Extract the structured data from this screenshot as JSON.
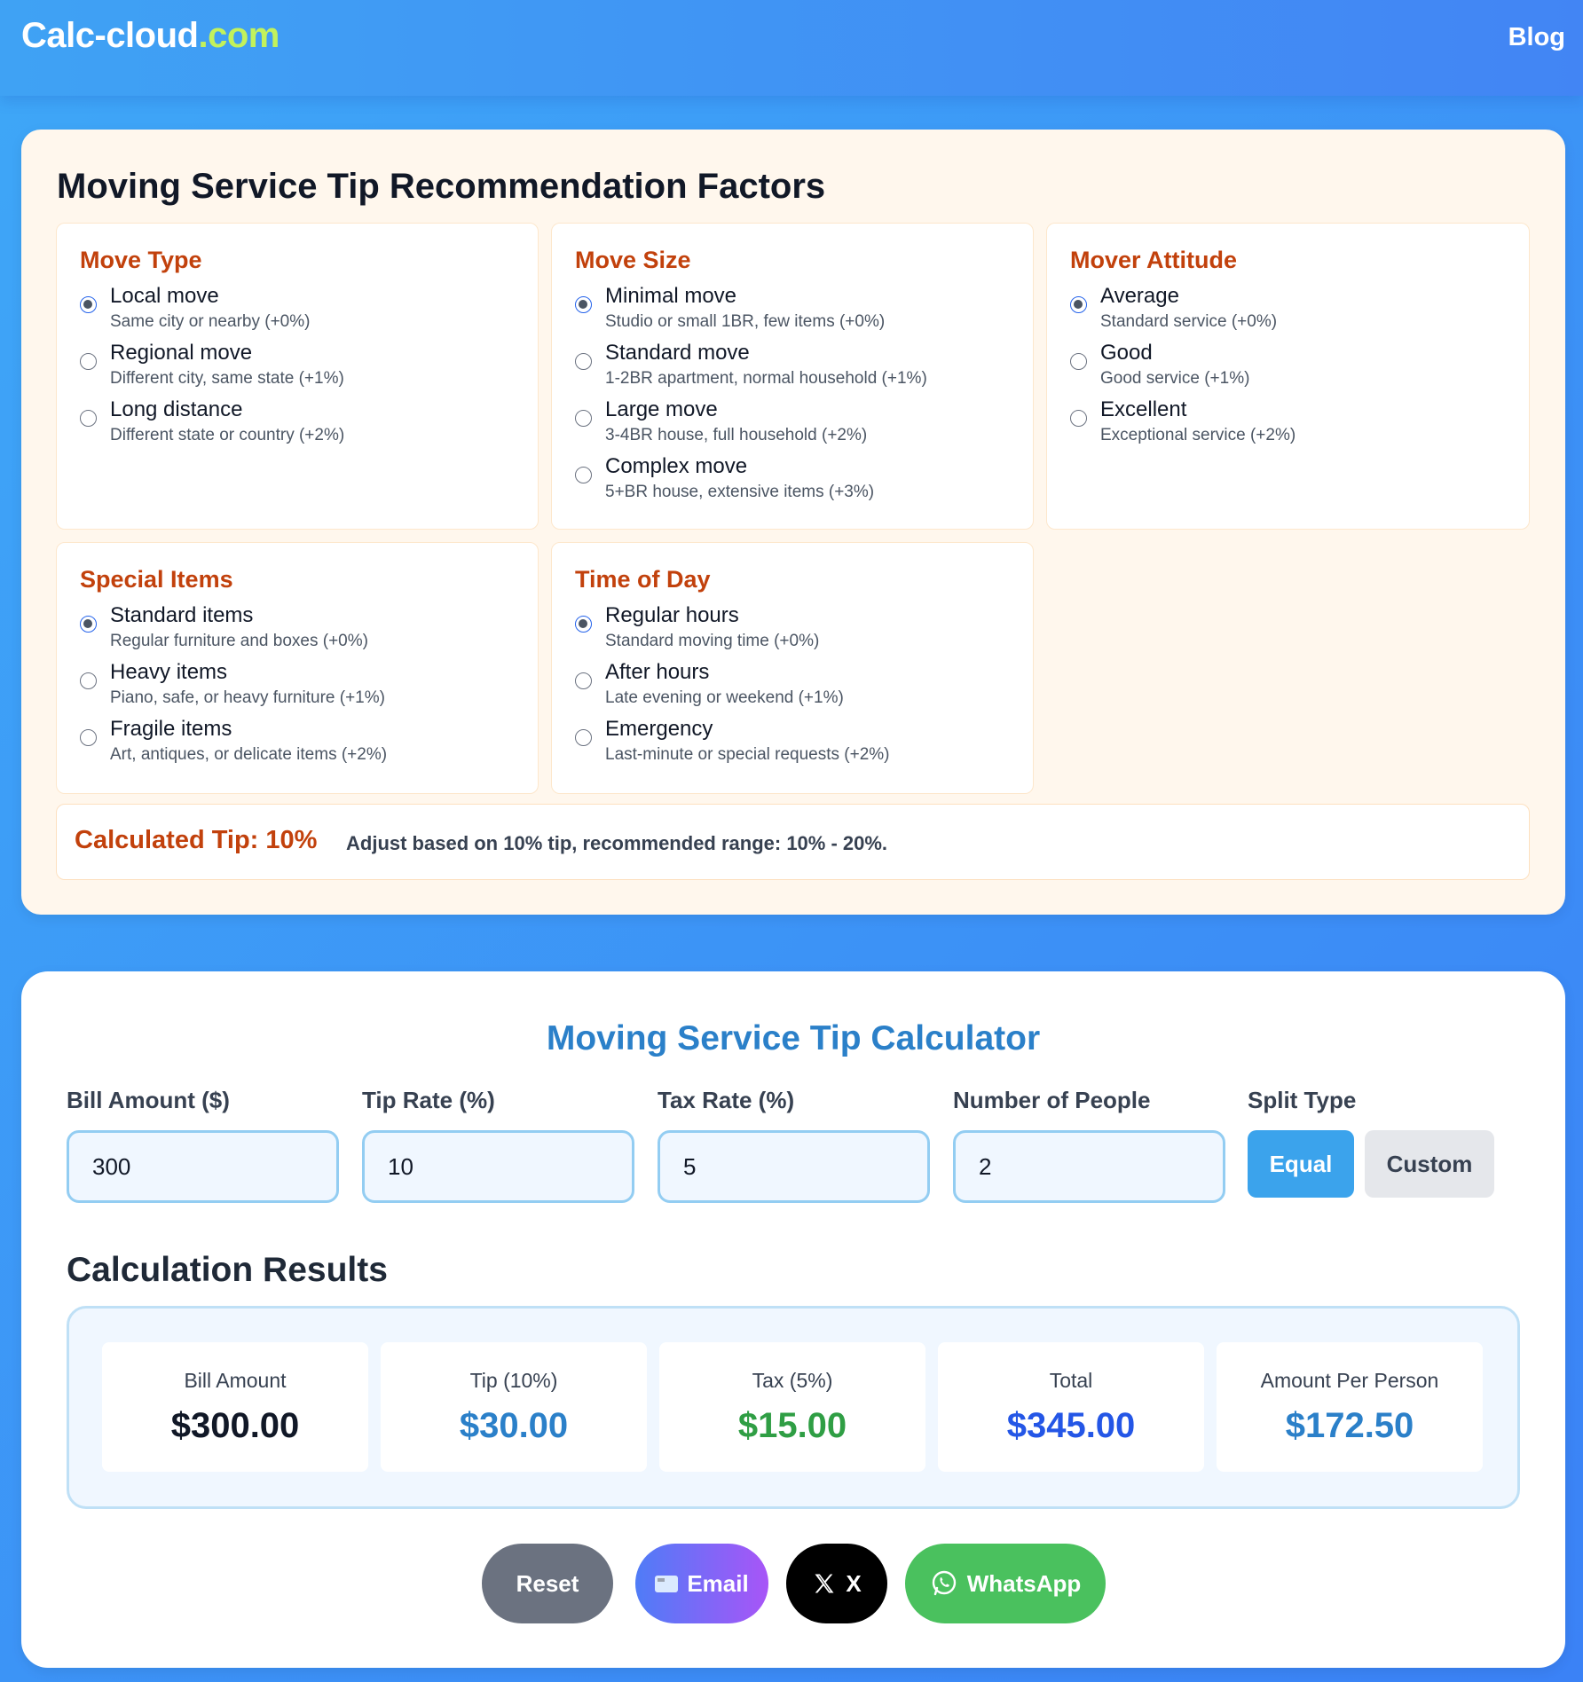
{
  "header": {
    "logo_main": "Calc-cloud",
    "logo_tld": ".com",
    "nav_blog": "Blog"
  },
  "factors": {
    "title": "Moving Service Tip Recommendation Factors",
    "move_type": {
      "title": "Move Type",
      "options": [
        {
          "label": "Local move",
          "desc": "Same city or nearby (+0%)",
          "checked": true
        },
        {
          "label": "Regional move",
          "desc": "Different city, same state (+1%)",
          "checked": false
        },
        {
          "label": "Long distance",
          "desc": "Different state or country (+2%)",
          "checked": false
        }
      ]
    },
    "move_size": {
      "title": "Move Size",
      "options": [
        {
          "label": "Minimal move",
          "desc": "Studio or small 1BR, few items (+0%)",
          "checked": true
        },
        {
          "label": "Standard move",
          "desc": "1-2BR apartment, normal household (+1%)",
          "checked": false
        },
        {
          "label": "Large move",
          "desc": "3-4BR house, full household (+2%)",
          "checked": false
        },
        {
          "label": "Complex move",
          "desc": "5+BR house, extensive items (+3%)",
          "checked": false
        }
      ]
    },
    "mover_attitude": {
      "title": "Mover Attitude",
      "options": [
        {
          "label": "Average",
          "desc": "Standard service (+0%)",
          "checked": true
        },
        {
          "label": "Good",
          "desc": "Good service (+1%)",
          "checked": false
        },
        {
          "label": "Excellent",
          "desc": "Exceptional service (+2%)",
          "checked": false
        }
      ]
    },
    "special_items": {
      "title": "Special Items",
      "options": [
        {
          "label": "Standard items",
          "desc": "Regular furniture and boxes (+0%)",
          "checked": true
        },
        {
          "label": "Heavy items",
          "desc": "Piano, safe, or heavy furniture (+1%)",
          "checked": false
        },
        {
          "label": "Fragile items",
          "desc": "Art, antiques, or delicate items (+2%)",
          "checked": false
        }
      ]
    },
    "time_of_day": {
      "title": "Time of Day",
      "options": [
        {
          "label": "Regular hours",
          "desc": "Standard moving time (+0%)",
          "checked": true
        },
        {
          "label": "After hours",
          "desc": "Late evening or weekend (+1%)",
          "checked": false
        },
        {
          "label": "Emergency",
          "desc": "Last-minute or special requests (+2%)",
          "checked": false
        }
      ]
    },
    "calculated_tip": "Calculated Tip: 10%",
    "calculated_note": "Adjust based on 10% tip, recommended range: 10% - 20%."
  },
  "calculator": {
    "title": "Moving Service Tip Calculator",
    "fields": {
      "bill": {
        "label": "Bill Amount ($)",
        "value": "300"
      },
      "tip": {
        "label": "Tip Rate (%)",
        "value": "10"
      },
      "tax": {
        "label": "Tax Rate (%)",
        "value": "5"
      },
      "people": {
        "label": "Number of People",
        "value": "2"
      }
    },
    "split": {
      "label": "Split Type",
      "equal": "Equal",
      "custom": "Custom",
      "selected": "Equal"
    },
    "results_title": "Calculation Results",
    "results": [
      {
        "label": "Bill Amount",
        "value": "$300.00",
        "color": "#111827"
      },
      {
        "label": "Tip (10%)",
        "value": "$30.00",
        "color": "#2b80c9"
      },
      {
        "label": "Tax (5%)",
        "value": "$15.00",
        "color": "#2f9e44"
      },
      {
        "label": "Total",
        "value": "$345.00",
        "color": "#2456e6"
      },
      {
        "label": "Amount Per Person",
        "value": "$172.50",
        "color": "#2b80c9"
      }
    ],
    "actions": {
      "reset": "Reset",
      "email": "Email",
      "x": "X",
      "whatsapp": "WhatsApp"
    }
  }
}
